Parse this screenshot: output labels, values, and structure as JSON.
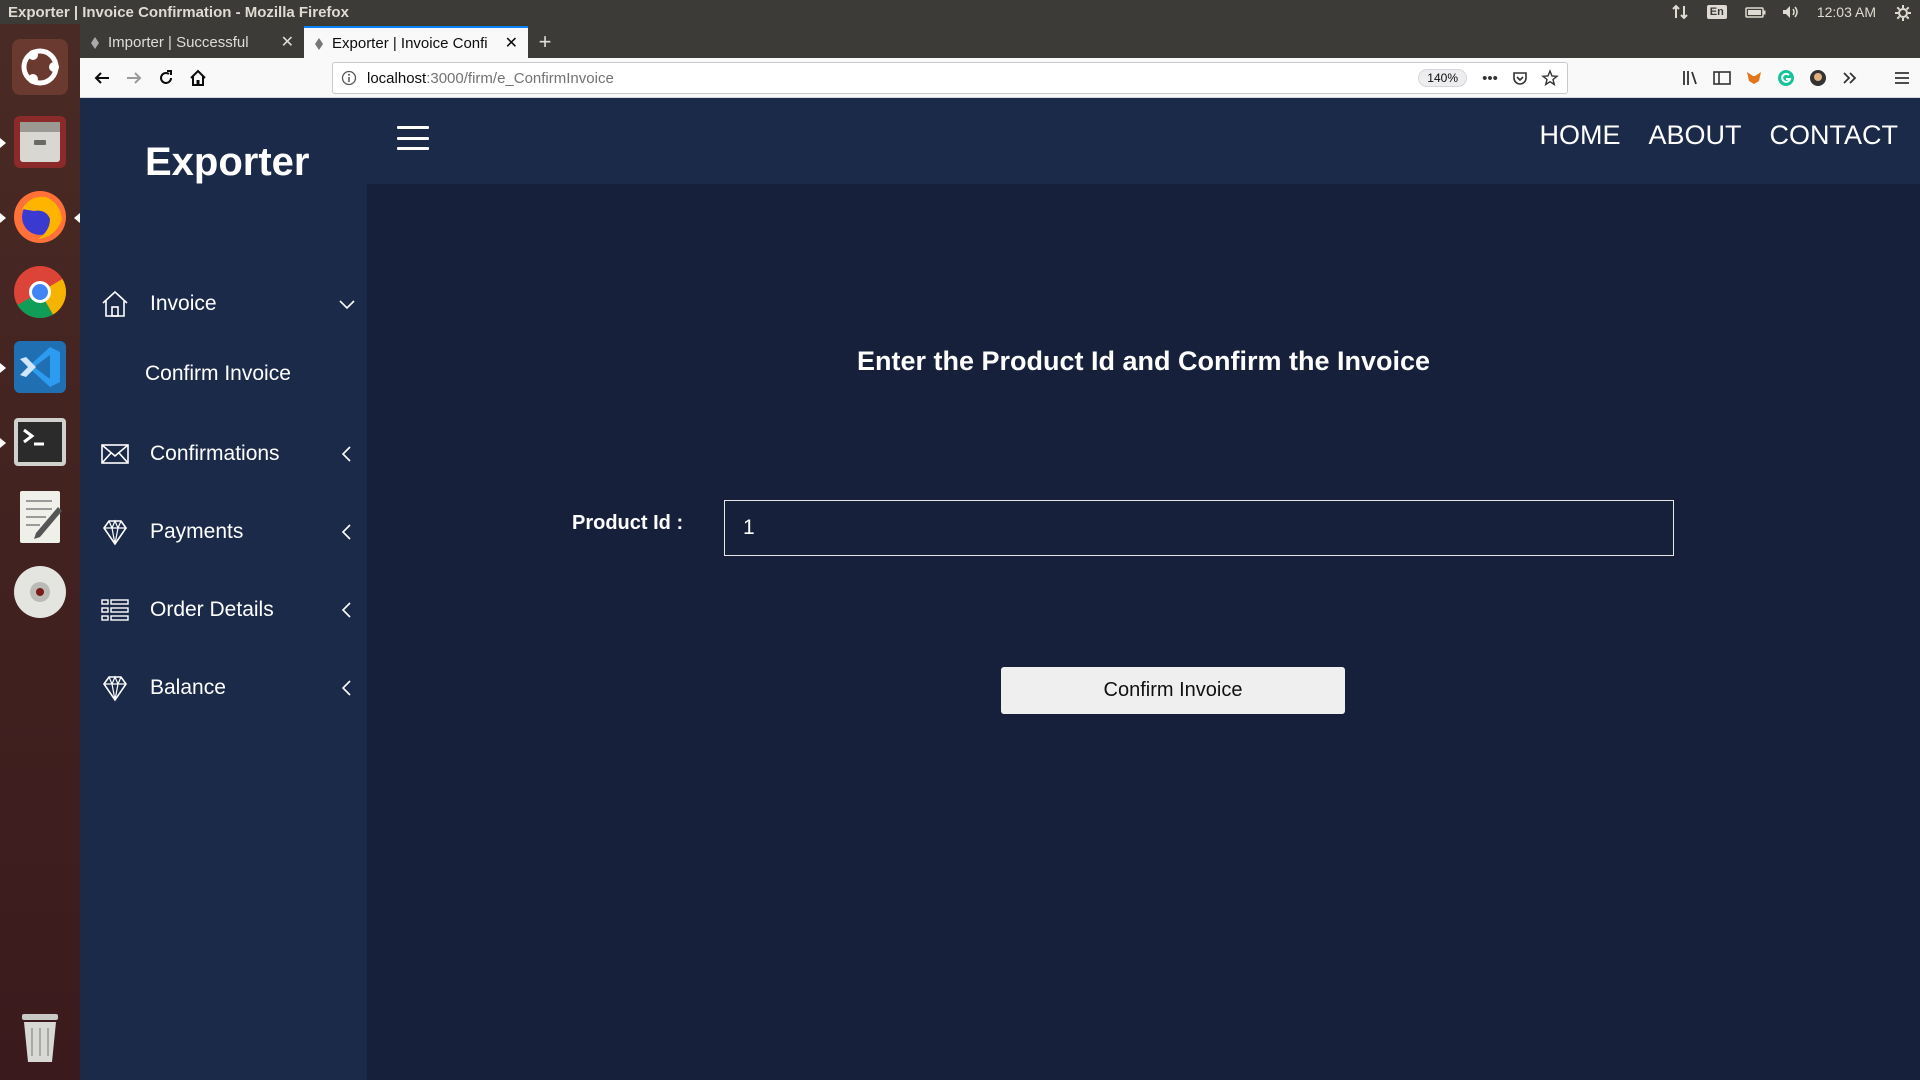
{
  "os": {
    "window_title": "Exporter | Invoice Confirmation - Mozilla Firefox",
    "lang": "En",
    "clock": "12:03 AM"
  },
  "launcher": {
    "items": [
      "ubuntu-dash",
      "files",
      "firefox",
      "chrome",
      "vscode",
      "terminal",
      "text-editor",
      "disc"
    ],
    "trash": "trash"
  },
  "browser": {
    "tabs": [
      {
        "title": "Importer | Successful",
        "active": false
      },
      {
        "title": "Exporter | Invoice Confi",
        "active": true
      }
    ],
    "url_host": "localhost",
    "url_path": ":3000/firm/e_ConfirmInvoice",
    "zoom": "140%",
    "page_actions_more": "•••"
  },
  "app": {
    "brand": "Exporter",
    "nav": {
      "home": "HOME",
      "about": "ABOUT",
      "contact": "CONTACT"
    },
    "sidebar": {
      "invoice": "Invoice",
      "confirm_invoice": "Confirm Invoice",
      "confirmations": "Confirmations",
      "payments": "Payments",
      "order_details": "Order Details",
      "balance": "Balance"
    },
    "main": {
      "heading": "Enter the Product Id and Confirm the Invoice",
      "product_id_label": "Product Id :",
      "product_id_value": "1",
      "confirm_button": "Confirm Invoice"
    }
  },
  "colors": {
    "page_bg": "#16203a",
    "sidebar_bg": "#1c2a4a",
    "launcher_bg": "#4a2a24",
    "tab_accent": "#0a84ff"
  }
}
